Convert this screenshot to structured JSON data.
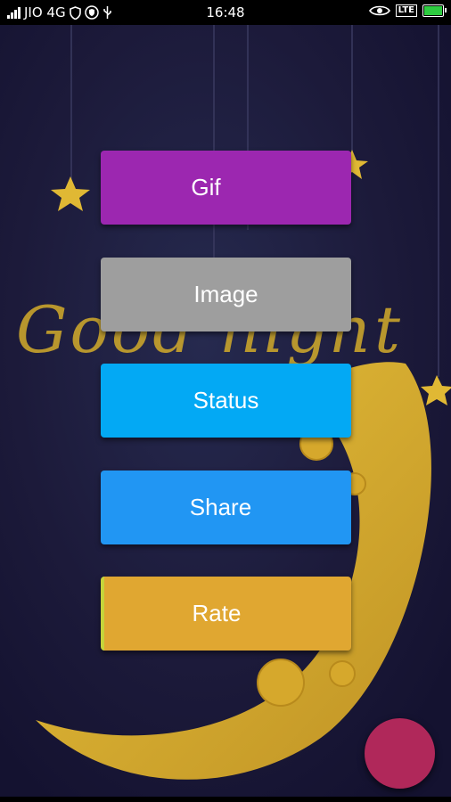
{
  "status_bar": {
    "carrier": "JIO 4G",
    "time": "16:48",
    "network_type": "LTE",
    "icons": [
      "signal-icon",
      "shield-icon",
      "vpn-icon",
      "usb-icon",
      "eye-icon",
      "lte-icon",
      "battery-charging-icon"
    ]
  },
  "background": {
    "text": "Good night"
  },
  "menu": {
    "gif_label": "Gif",
    "image_label": "Image",
    "status_label": "Status",
    "share_label": "Share",
    "rate_label": "Rate"
  },
  "colors": {
    "gif": "#9c27b0",
    "image": "#9e9e9e",
    "status": "#03a9f4",
    "share": "#2196f3",
    "rate": "#e0a731",
    "fab": "#b0285a",
    "background": "#1c1a3a",
    "moon": "#e0b834"
  }
}
